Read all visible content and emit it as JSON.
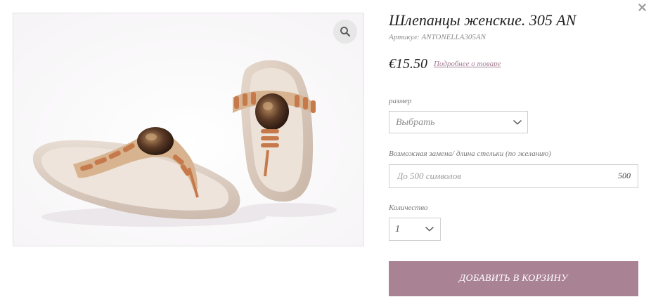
{
  "product": {
    "title": "Шлепанцы женские. 305 AN",
    "sku": "Артикул: ANTONELLA305AN",
    "price": "€15.50",
    "details_link": "Подробнее о товаре",
    "image_alt": "sandals-photo"
  },
  "icons": {
    "zoom": "magnifier-icon",
    "close": "close-icon",
    "dropdown": "chevron-down-icon"
  },
  "size": {
    "label": "размер",
    "value": "Выбрать"
  },
  "replacement": {
    "label": "Возможная замена/ длина стельки (по желанию)",
    "placeholder": "До 500 символов",
    "counter": "500"
  },
  "quantity": {
    "label": "Количество",
    "value": "1"
  },
  "cart_button": {
    "label": "ДОБАВИТЬ В КОРЗИНУ"
  },
  "colors": {
    "accent": "#a98294",
    "link": "#a17b91"
  }
}
